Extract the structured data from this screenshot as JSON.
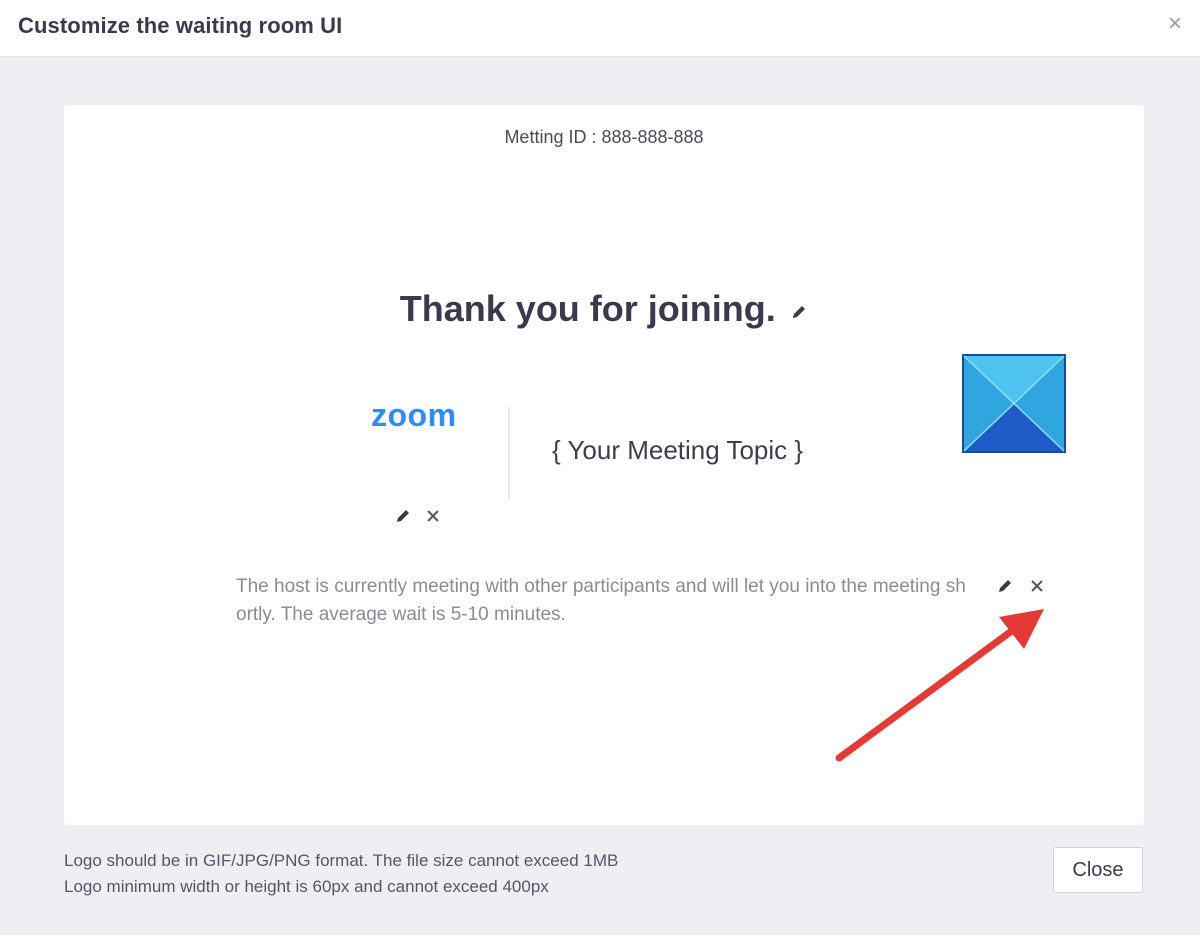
{
  "dialog": {
    "title": "Customize the waiting room UI",
    "close_glyph": "×"
  },
  "preview": {
    "meeting_id": "Metting ID : 888-888-888",
    "welcome_title": "Thank you for joining.",
    "logo_text": "zoom",
    "topic": "{ Your Meeting Topic }",
    "description": "The host is currently meeting with other participants and will let you into the meeting shortly. The average wait is 5-10 minutes."
  },
  "footer": {
    "note_line1": "Logo should be in GIF/JPG/PNG format. The file size cannot exceed 1MB",
    "note_line2": "Logo minimum width or height is 60px and cannot exceed 400px",
    "close_label": "Close"
  },
  "icons": {
    "edit": "pencil-icon",
    "remove": "close-icon",
    "annotation": "arrow-icon"
  },
  "colors": {
    "accent": "#2d8cff",
    "annotation": "#e53935",
    "background": "#eeeff3"
  }
}
